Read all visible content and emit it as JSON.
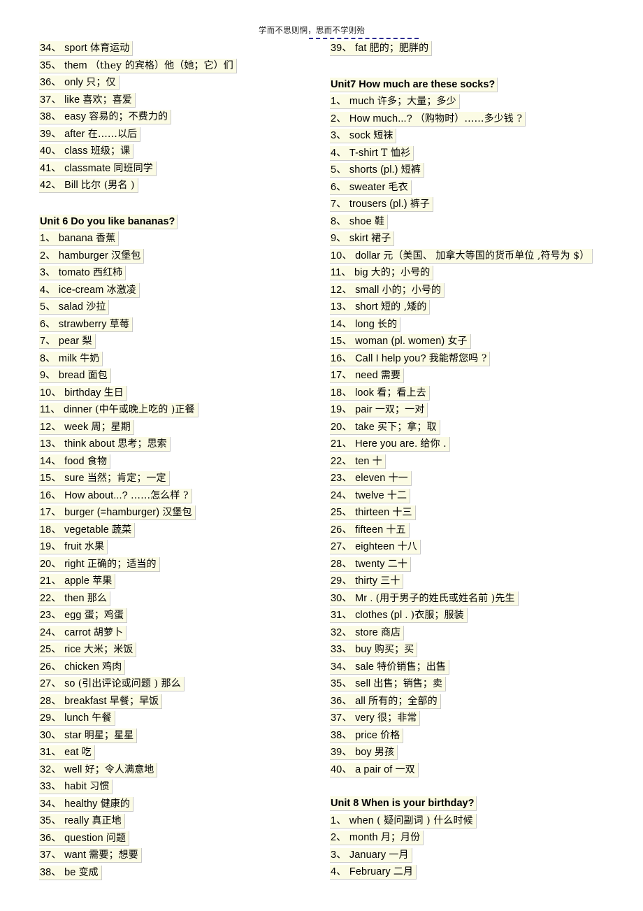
{
  "header": {
    "motto": "学而不思则惘，思而不学则殆",
    "rule_color": "#2b2b8f"
  },
  "theme": {
    "chip_background": "#fbfbe4",
    "chip_border": "#c9c9c9",
    "page_background": "#ffffff",
    "text_color": "#000000"
  },
  "left_column": {
    "unit5_tail": {
      "items": [
        {
          "num": "34、",
          "en": "sport",
          "zh": "体育运动"
        },
        {
          "num": "35、",
          "en": "them",
          "zh": "（they  的宾格）他（她；它）们"
        },
        {
          "num": "36、",
          "en": "only",
          "zh": "只；仅"
        },
        {
          "num": "37、",
          "en": "like",
          "zh": "喜欢；喜爱"
        },
        {
          "num": "38、",
          "en": "easy",
          "zh": "容易的；不费力的"
        },
        {
          "num": "39、",
          "en": "after",
          "zh": "在……以后"
        },
        {
          "num": "40、",
          "en": "class",
          "zh": "班级；课"
        },
        {
          "num": "41、",
          "en": "classmate",
          "zh": "同班同学"
        },
        {
          "num": "42、",
          "en": "Bill",
          "zh": "比尔 (男名 )"
        }
      ]
    },
    "unit6": {
      "heading": "Unit 6 Do you like bananas?",
      "items": [
        {
          "num": "1、",
          "en": "banana",
          "zh": "香蕉"
        },
        {
          "num": "2、",
          "en": "hamburger",
          "zh": "汉堡包"
        },
        {
          "num": "3、",
          "en": "tomato",
          "zh": "西红柿"
        },
        {
          "num": "4、",
          "en": "ice-cream",
          "zh": "冰激凌"
        },
        {
          "num": "5、",
          "en": "salad",
          "zh": "沙拉"
        },
        {
          "num": "6、",
          "en": "strawberry",
          "zh": "草莓"
        },
        {
          "num": "7、",
          "en": "pear",
          "zh": "梨"
        },
        {
          "num": "8、",
          "en": "milk",
          "zh": "牛奶"
        },
        {
          "num": "9、",
          "en": "bread",
          "zh": "面包"
        },
        {
          "num": "10、",
          "en": "birthday",
          "zh": "生日"
        },
        {
          "num": "11、",
          "en": "dinner",
          "zh": "(中午或晚上吃的  )正餐"
        },
        {
          "num": "12、",
          "en": "week",
          "zh": "周；星期"
        },
        {
          "num": "13、",
          "en": "think about",
          "zh": "思考；思索"
        },
        {
          "num": "14、",
          "en": "food",
          "zh": "食物"
        },
        {
          "num": "15、",
          "en": "sure",
          "zh": "当然；肯定；一定"
        },
        {
          "num": "16、",
          "en": "How about...?",
          "zh": "……怎么样 ?"
        },
        {
          "num": "17、",
          "en": "burger (=hamburger)",
          "zh": "汉堡包"
        },
        {
          "num": "18、",
          "en": "vegetable",
          "zh": "蔬菜"
        },
        {
          "num": "19、",
          "en": "fruit",
          "zh": "水果"
        },
        {
          "num": "20、",
          "en": "right",
          "zh": "正确的；适当的"
        },
        {
          "num": "21、",
          "en": "apple",
          "zh": "苹果"
        },
        {
          "num": "22、",
          "en": "then",
          "zh": "那么"
        },
        {
          "num": "23、",
          "en": "egg",
          "zh": "蛋；鸡蛋"
        },
        {
          "num": "24、",
          "en": "carrot",
          "zh": "胡萝卜"
        },
        {
          "num": "25、",
          "en": "rice",
          "zh": "大米；米饭"
        },
        {
          "num": "26、",
          "en": "chicken",
          "zh": "鸡肉"
        },
        {
          "num": "27、",
          "en": "so",
          "zh": "(引出评论或问题  ) 那么"
        },
        {
          "num": "28、",
          "en": "breakfast",
          "zh": "早餐；早饭"
        },
        {
          "num": "29、",
          "en": "lunch",
          "zh": "午餐"
        },
        {
          "num": "30、",
          "en": "star",
          "zh": "明星；星星"
        },
        {
          "num": "31、",
          "en": "eat",
          "zh": "吃"
        },
        {
          "num": "32、",
          "en": "well",
          "zh": "好；令人满意地"
        },
        {
          "num": "33、",
          "en": "habit",
          "zh": "习惯"
        },
        {
          "num": "34、",
          "en": "healthy",
          "zh": "健康的"
        },
        {
          "num": "35、",
          "en": "really",
          "zh": "真正地"
        },
        {
          "num": "36、",
          "en": "question",
          "zh": "问题"
        },
        {
          "num": "37、",
          "en": "want",
          "zh": "需要；想要"
        },
        {
          "num": "38、",
          "en": "be",
          "zh": "变成"
        }
      ]
    }
  },
  "right_column": {
    "unit6_tail": {
      "items": [
        {
          "num": "39、",
          "en": "fat",
          "zh": "肥的；肥胖的"
        }
      ]
    },
    "unit7": {
      "heading": "Unit7 How much are these socks?",
      "items": [
        {
          "num": "1、",
          "en": "much",
          "zh": "许多；大量；多少"
        },
        {
          "num": "2、",
          "en": "How much...?",
          "zh": "（购物时）……多少钱  ?"
        },
        {
          "num": "3、",
          "en": "sock",
          "zh": "短袜"
        },
        {
          "num": "4、",
          "en": "T-shirt",
          "zh": "T 恤衫"
        },
        {
          "num": "5、",
          "en": "shorts (pl.)",
          "zh": "短裤"
        },
        {
          "num": "6、",
          "en": "sweater",
          "zh": "毛衣"
        },
        {
          "num": "7、",
          "en": "trousers (pl.)",
          "zh": "裤子"
        },
        {
          "num": "8、",
          "en": "shoe",
          "zh": "鞋"
        },
        {
          "num": "9、",
          "en": "skirt",
          "zh": "裙子"
        },
        {
          "num": "10、",
          "en": "dollar",
          "zh": "元（美国、 加拿大等国的货币单位   ,符号为 $）"
        },
        {
          "num": "11、",
          "en": "big",
          "zh": "大的；小号的"
        },
        {
          "num": "12、",
          "en": "small",
          "zh": "小的；小号的"
        },
        {
          "num": "13、",
          "en": "short",
          "zh": "短的 ,矮的"
        },
        {
          "num": "14、",
          "en": "long",
          "zh": "长的"
        },
        {
          "num": "15、",
          "en": "woman (pl. women)",
          "zh": "女子"
        },
        {
          "num": "16、",
          "en": "Call I help you?",
          "zh": "我能帮您吗 ?"
        },
        {
          "num": "17、",
          "en": "need",
          "zh": "需要"
        },
        {
          "num": "18、",
          "en": "look",
          "zh": "看；看上去"
        },
        {
          "num": "19、",
          "en": "pair",
          "zh": "一双；一对"
        },
        {
          "num": "20、",
          "en": "take",
          "zh": "买下；拿；取"
        },
        {
          "num": "21、",
          "en": "Here you are.",
          "zh": "给你 ."
        },
        {
          "num": "22、",
          "en": "ten",
          "zh": "十"
        },
        {
          "num": "23、",
          "en": "eleven",
          "zh": "十一"
        },
        {
          "num": "24、",
          "en": "twelve",
          "zh": "十二"
        },
        {
          "num": "25、",
          "en": "thirteen",
          "zh": "十三"
        },
        {
          "num": "26、",
          "en": "fifteen",
          "zh": "十五"
        },
        {
          "num": "27、",
          "en": "eighteen",
          "zh": "十八"
        },
        {
          "num": "28、",
          "en": "twenty",
          "zh": "二十"
        },
        {
          "num": "29、",
          "en": "thirty",
          "zh": "三十"
        },
        {
          "num": "30、",
          "en": "Mr .",
          "zh": "(用于男子的姓氏或姓名前   )先生"
        },
        {
          "num": "31、",
          "en": "clothes (pl .",
          "zh": ")衣服；服装"
        },
        {
          "num": "32、",
          "en": "store",
          "zh": "商店"
        },
        {
          "num": "33、",
          "en": "buy",
          "zh": "购买；买"
        },
        {
          "num": "34、",
          "en": "sale",
          "zh": "特价销售；出售"
        },
        {
          "num": "35、",
          "en": "sell",
          "zh": "出售；销售；卖"
        },
        {
          "num": "36、",
          "en": "all",
          "zh": "所有的；全部的"
        },
        {
          "num": "37、",
          "en": "very",
          "zh": "很；非常"
        },
        {
          "num": "38、",
          "en": "price",
          "zh": "价格"
        },
        {
          "num": "39、",
          "en": "boy",
          "zh": "男孩"
        },
        {
          "num": "40、",
          "en": "a pair of",
          "zh": "一双"
        }
      ]
    },
    "unit8": {
      "heading": "Unit 8 When is your birthday?",
      "items": [
        {
          "num": "1、",
          "en": "when",
          "zh": "( 疑问副词 )  什么时候"
        },
        {
          "num": "2、",
          "en": "month",
          "zh": "月；月份"
        },
        {
          "num": "3、",
          "en": "January",
          "zh": "一月"
        },
        {
          "num": "4、",
          "en": "February",
          "zh": "二月"
        }
      ]
    }
  }
}
